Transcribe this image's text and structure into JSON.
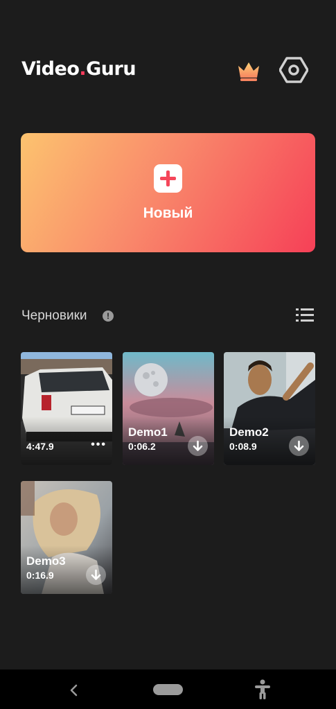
{
  "app": {
    "logo_prefix": "Video",
    "logo_dot": ".",
    "logo_suffix": "Guru"
  },
  "header": {
    "premium_icon": "crown-icon",
    "settings_icon": "gear-icon"
  },
  "new_project": {
    "label": "Новый",
    "icon": "plus-icon"
  },
  "drafts": {
    "title": "Черновики",
    "info_symbol": "!",
    "view_icon": "list-view-icon",
    "items": [
      {
        "name": "",
        "duration": "4:47.9",
        "more": "•••"
      },
      {
        "name": "Demo1",
        "duration": "0:06.2"
      },
      {
        "name": "Demo2",
        "duration": "0:08.9"
      },
      {
        "name": "Demo3",
        "duration": "0:16.9"
      }
    ]
  },
  "colors": {
    "background": "#1c1c1c",
    "gradient_start": "#fcc36f",
    "gradient_end": "#f64057",
    "accent": "#ff3b5c"
  },
  "system_nav": {
    "back_icon": "back-chevron-icon",
    "home_icon": "home-pill",
    "accessibility_icon": "accessibility-icon"
  }
}
